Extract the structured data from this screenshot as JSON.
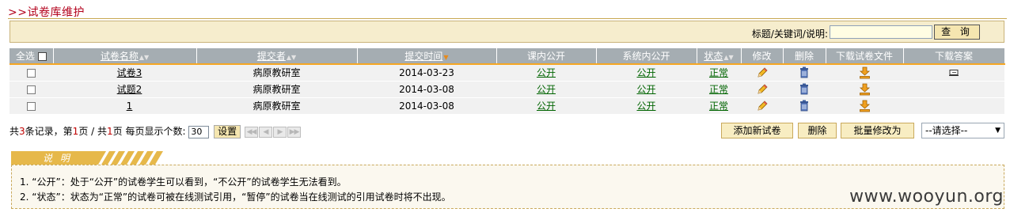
{
  "page": {
    "title": ">>试卷库维护"
  },
  "search": {
    "label": "标题/关键词/说明:",
    "value": "",
    "button_label": "查 询"
  },
  "table": {
    "select_all_label": "全选",
    "headers": {
      "name": "试卷名称",
      "submitter": "提交者",
      "submit_time": "提交时间",
      "course_public": "课内公开",
      "system_public": "系统内公开",
      "status": "状态",
      "edit": "修改",
      "delete": "删除",
      "download_paper": "下载试卷文件",
      "download_answer": "下载答案"
    },
    "rows": [
      {
        "name": "试卷3",
        "submitter": "病原教研室",
        "submit_time": "2014-03-23",
        "course_public": "公开",
        "system_public": "公开",
        "status": "正常",
        "has_answer": true
      },
      {
        "name": "试题2",
        "submitter": "病原教研室",
        "submit_time": "2014-03-08",
        "course_public": "公开",
        "system_public": "公开",
        "status": "正常",
        "has_answer": false
      },
      {
        "name": "1",
        "submitter": "病原教研室",
        "submit_time": "2014-03-08",
        "course_public": "公开",
        "system_public": "公开",
        "status": "正常",
        "has_answer": false
      }
    ]
  },
  "pager": {
    "prefix": "共",
    "total_count": "3",
    "records_suffix": "条记录，第",
    "current_page": "1",
    "page_suffix": "页 / 共",
    "total_pages": "1",
    "per_page_label": "页 每页显示个数:",
    "page_size": "30",
    "set_label": "设置"
  },
  "actions": {
    "add_label": "添加新试卷",
    "delete_label": "删除",
    "batch_label": "批量修改为",
    "select_value": "--请选择--"
  },
  "notice": {
    "title": "说 明",
    "lines": [
      "1. “公开”：处于“公开”的试卷学生可以看到，“不公开”的试卷学生无法看到。",
      "2. “状态”：状态为“正常”的试卷可被在线测试引用，“暂停”的试卷当在线测试的引用试卷时将不出现。"
    ]
  },
  "watermark": "www.wooyun.org",
  "colors": {
    "title": "#b3001b",
    "header_bg": "#a5adb2",
    "search_bg": "#f6edcd",
    "link_green": "#006400",
    "accent": "#f5a623"
  }
}
